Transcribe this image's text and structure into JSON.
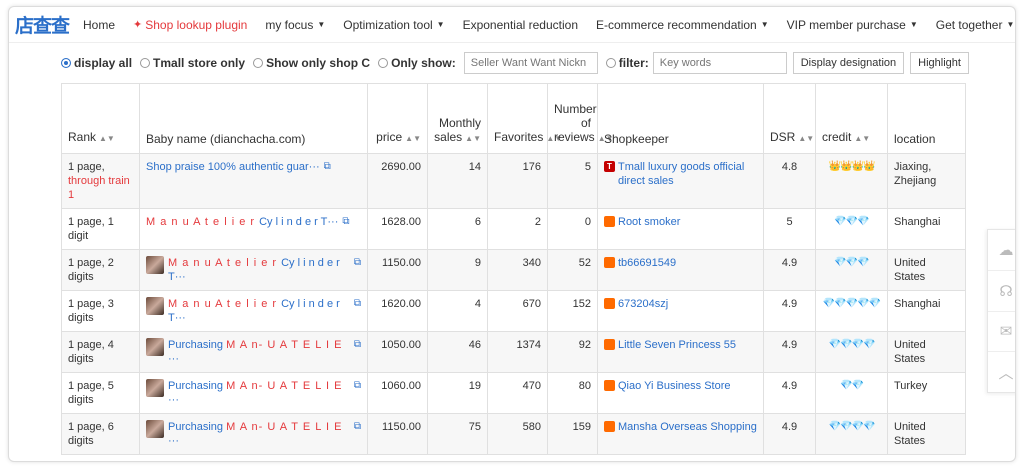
{
  "nav": {
    "logo": "店查查",
    "items": [
      {
        "label": "Home",
        "caret": false,
        "active": false
      },
      {
        "label": "Shop lookup plugin",
        "caret": false,
        "active": true
      },
      {
        "label": "my focus",
        "caret": true,
        "active": false
      },
      {
        "label": "Optimization tool",
        "caret": true,
        "active": false
      },
      {
        "label": "Exponential reduction",
        "caret": false,
        "active": false
      },
      {
        "label": "E-commerce recommendation",
        "caret": true,
        "active": false
      },
      {
        "label": "VIP member purchase",
        "caret": true,
        "active": false
      },
      {
        "label": "Get together",
        "caret": true,
        "active": false
      }
    ]
  },
  "filters": {
    "display_all": "display all",
    "tmall_only": "Tmall store only",
    "shop_c": "Show only shop C",
    "only_show": "Only show:",
    "seller_placeholder": "Seller Want Want Nickn",
    "filter": "filter:",
    "keywords_placeholder": "Key words",
    "display_designation": "Display designation",
    "highlight": "Highlight"
  },
  "table": {
    "headers": {
      "rank": "Rank",
      "baby": "Baby name (dianchacha.com)",
      "price": "price",
      "monthly": "Monthly sales",
      "favorites": "Favorites",
      "reviews": "Number of reviews",
      "shopkeeper": "Shopkeeper",
      "dsr": "DSR",
      "credit": "credit",
      "location": "location"
    },
    "rows": [
      {
        "rank": "1 page,",
        "rank_extra": "through train 1",
        "thumb": false,
        "prefix": "",
        "name_red": "",
        "name_blue": "Shop praise 100% authentic guar···",
        "price": "2690.00",
        "monthly": "14",
        "favorites": "176",
        "reviews": "5",
        "shop_badge": "tmall",
        "shop_badge_text": "T",
        "shop": "Tmall luxury goods official direct sales",
        "dsr": "4.8",
        "credit": "👑👑👑👑",
        "location": "Jiaxing, Zhejiang"
      },
      {
        "rank": "1 page, 1 digit",
        "rank_extra": "",
        "thumb": false,
        "prefix": "",
        "name_red": "M a n u A t e l i e r ",
        "name_blue": "Cy l i n d e r T···",
        "price": "1628.00",
        "monthly": "6",
        "favorites": "2",
        "reviews": "0",
        "shop_badge": "taobao",
        "shop_badge_text": "",
        "shop": "Root smoker",
        "dsr": "5",
        "credit": "💎💎💎",
        "location": "Shanghai"
      },
      {
        "rank": "1 page, 2 digits",
        "rank_extra": "",
        "thumb": true,
        "prefix": "",
        "name_red": "M a n u A t e l i e r ",
        "name_blue": "Cy l i n d e r T···",
        "price": "1150.00",
        "monthly": "9",
        "favorites": "340",
        "reviews": "52",
        "shop_badge": "taobao",
        "shop_badge_text": "",
        "shop": "tb66691549",
        "dsr": "4.9",
        "credit": "💎💎💎",
        "location": "United States"
      },
      {
        "rank": "1 page, 3 digits",
        "rank_extra": "",
        "thumb": true,
        "prefix": "",
        "name_red": "M a n u A t e l i e r ",
        "name_blue": "Cy l i n d e r T···",
        "price": "1620.00",
        "monthly": "4",
        "favorites": "670",
        "reviews": "152",
        "shop_badge": "taobao",
        "shop_badge_text": "",
        "shop": "673204szj",
        "dsr": "4.9",
        "credit": "💎💎💎💎💎",
        "location": "Shanghai"
      },
      {
        "rank": "1 page, 4 digits",
        "rank_extra": "",
        "thumb": true,
        "prefix": "Purchasing ",
        "name_red": "M A n- U A T E L I E ",
        "name_blue": "···",
        "price": "1050.00",
        "monthly": "46",
        "favorites": "1374",
        "reviews": "92",
        "shop_badge": "taobao",
        "shop_badge_text": "",
        "shop": "Little Seven Princess 55",
        "dsr": "4.9",
        "credit": "💎💎💎💎",
        "location": "United States"
      },
      {
        "rank": "1 page, 5 digits",
        "rank_extra": "",
        "thumb": true,
        "prefix": "Purchasing ",
        "name_red": "M A n- U A T E L I E ",
        "name_blue": "···",
        "price": "1060.00",
        "monthly": "19",
        "favorites": "470",
        "reviews": "80",
        "shop_badge": "taobao",
        "shop_badge_text": "",
        "shop": "Qiao Yi Business Store",
        "dsr": "4.9",
        "credit": "💎💎",
        "location": "Turkey"
      },
      {
        "rank": "1 page, 6 digits",
        "rank_extra": "",
        "thumb": true,
        "prefix": "Purchasing ",
        "name_red": "M A n- U A T E L I E ",
        "name_blue": "···",
        "price": "1150.00",
        "monthly": "75",
        "favorites": "580",
        "reviews": "159",
        "shop_badge": "taobao",
        "shop_badge_text": "",
        "shop": "Mansha Overseas Shopping",
        "dsr": "4.9",
        "credit": "💎💎💎💎",
        "location": "United States"
      }
    ]
  },
  "side_icons": [
    "cloud-icon",
    "headset-icon",
    "wechat-icon",
    "back-to-top-icon"
  ],
  "colors": {
    "accent_blue": "#2b6fc9",
    "accent_red": "#e4393c",
    "tmall_red": "#c40000",
    "taobao_orange": "#ff6a00"
  }
}
